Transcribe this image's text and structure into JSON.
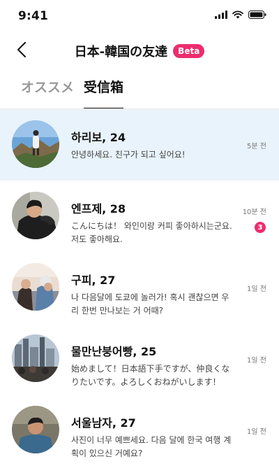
{
  "status_bar": {
    "time": "9:41"
  },
  "header": {
    "title": "日本-韓国の友達",
    "badge": "Beta"
  },
  "tabs": [
    {
      "label": "オススメ",
      "active": false
    },
    {
      "label": "受信箱",
      "active": true
    }
  ],
  "conversations": [
    {
      "name": "하리보, 24",
      "preview": "안녕하세요. 친구가 되고 싶어요!",
      "time": "5분 전",
      "unread": "",
      "highlighted": true
    },
    {
      "name": "엔프제, 28",
      "preview": "こんにちは！ 와인이랑 커피 좋아하시는군요. 저도 좋아해요.",
      "time": "10분 전",
      "unread": "3",
      "highlighted": false
    },
    {
      "name": "구피, 27",
      "preview": "나 다음달에 도쿄에 놀러가! 혹시 괜찮으면 우리 한번 만나보는 거 어때?",
      "time": "1일 전",
      "unread": "",
      "highlighted": false
    },
    {
      "name": "물만난붕어빵, 25",
      "preview": "始めまして！日本語下手ですが、仲良くなりたいです。よろしくおねがいします！",
      "time": "1일 전",
      "unread": "",
      "highlighted": false
    },
    {
      "name": "서울남자, 27",
      "preview": "사진이 너무 예쁘세요. 다음 달에 한국 여행 계획이 있으신 거예요?",
      "time": "1일 전",
      "unread": "",
      "highlighted": false
    }
  ],
  "colors": {
    "accent": "#ec2d6d",
    "highlight": "#e9f3fb",
    "muted": "#9a9a9a"
  },
  "icons": {
    "back": "chevron-left-icon",
    "signal": "signal-icon",
    "wifi": "wifi-icon",
    "battery": "battery-icon"
  }
}
